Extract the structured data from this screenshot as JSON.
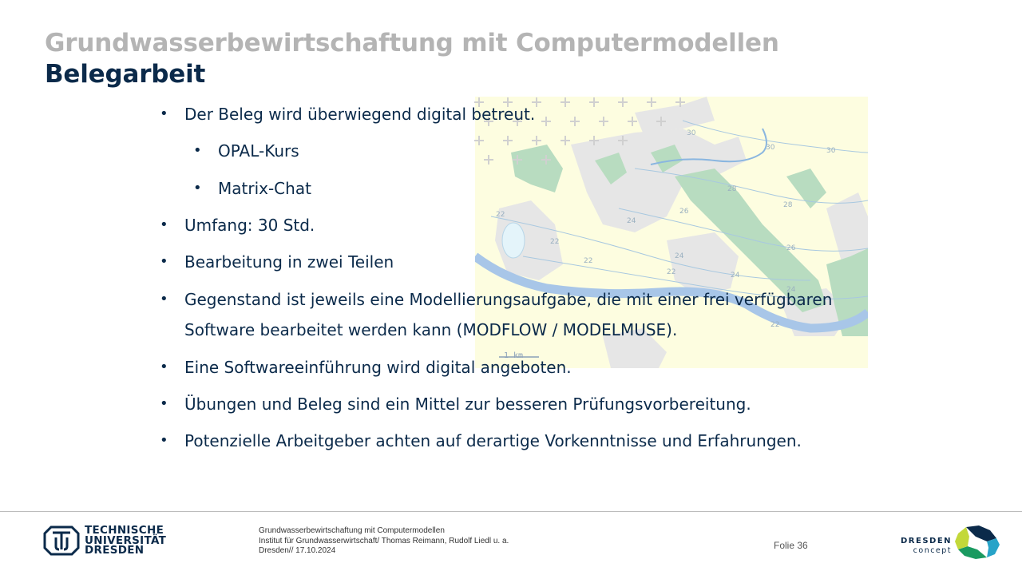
{
  "header": {
    "title_gray": "Grundwasserbewirtschaftung mit Computermodellen",
    "title_dark": "Belegarbeit"
  },
  "bullets": [
    {
      "level": 1,
      "text": "Der Beleg wird überwiegend digital betreut."
    },
    {
      "level": 2,
      "text": "OPAL-Kurs"
    },
    {
      "level": 2,
      "text": "Matrix-Chat"
    },
    {
      "level": 1,
      "text": "Umfang: 30 Std."
    },
    {
      "level": 1,
      "text": "Bearbeitung in zwei Teilen"
    },
    {
      "level": 1,
      "text": "Gegenstand ist jeweils eine Modellierungsaufgabe, die mit einer frei verfügbaren"
    },
    {
      "level": 0,
      "text": "Software bearbeitet werden kann (MODFLOW / MODELMUSE)."
    },
    {
      "level": 1,
      "text": "Eine Softwareeinführung wird digital angeboten."
    },
    {
      "level": 1,
      "text": "Übungen und Beleg sind ein Mittel zur besseren Prüfungsvorbereitung."
    },
    {
      "level": 1,
      "text": "Potenzielle Arbeitgeber achten auf derartige Vorkenntnisse und Erfahrungen."
    }
  ],
  "bullet_glyph": "•",
  "map": {
    "scale_label": "1 km",
    "contour_labels": [
      "30",
      "30",
      "30",
      "28",
      "28",
      "26",
      "26",
      "24",
      "24",
      "24",
      "22",
      "22",
      "22",
      "22",
      "22",
      "24"
    ],
    "colors": {
      "land": "#fdfde0",
      "urban": "#e8e8e8",
      "forest": "#b8dcc0",
      "river": "#a8c6e8",
      "contour": "#a8c8e0"
    }
  },
  "footer": {
    "university_lines": [
      "TECHNISCHE",
      "UNIVERSITÄT",
      "DRESDEN"
    ],
    "course": "Grundwasserbewirtschaftung mit Computermodellen",
    "institute": "Institut für Grundwasserwirtschaft/ Thomas Reimann, Rudolf Liedl u. a.",
    "place_date": "Dresden// 17.10.2024",
    "slide_number": "Folie 36",
    "partner_line1": "DRESDEN",
    "partner_line2": "concept"
  },
  "colors": {
    "accent_dark": "#0b2a4a",
    "title_gray": "#b4b4b4",
    "divider": "#bcbcbc"
  }
}
